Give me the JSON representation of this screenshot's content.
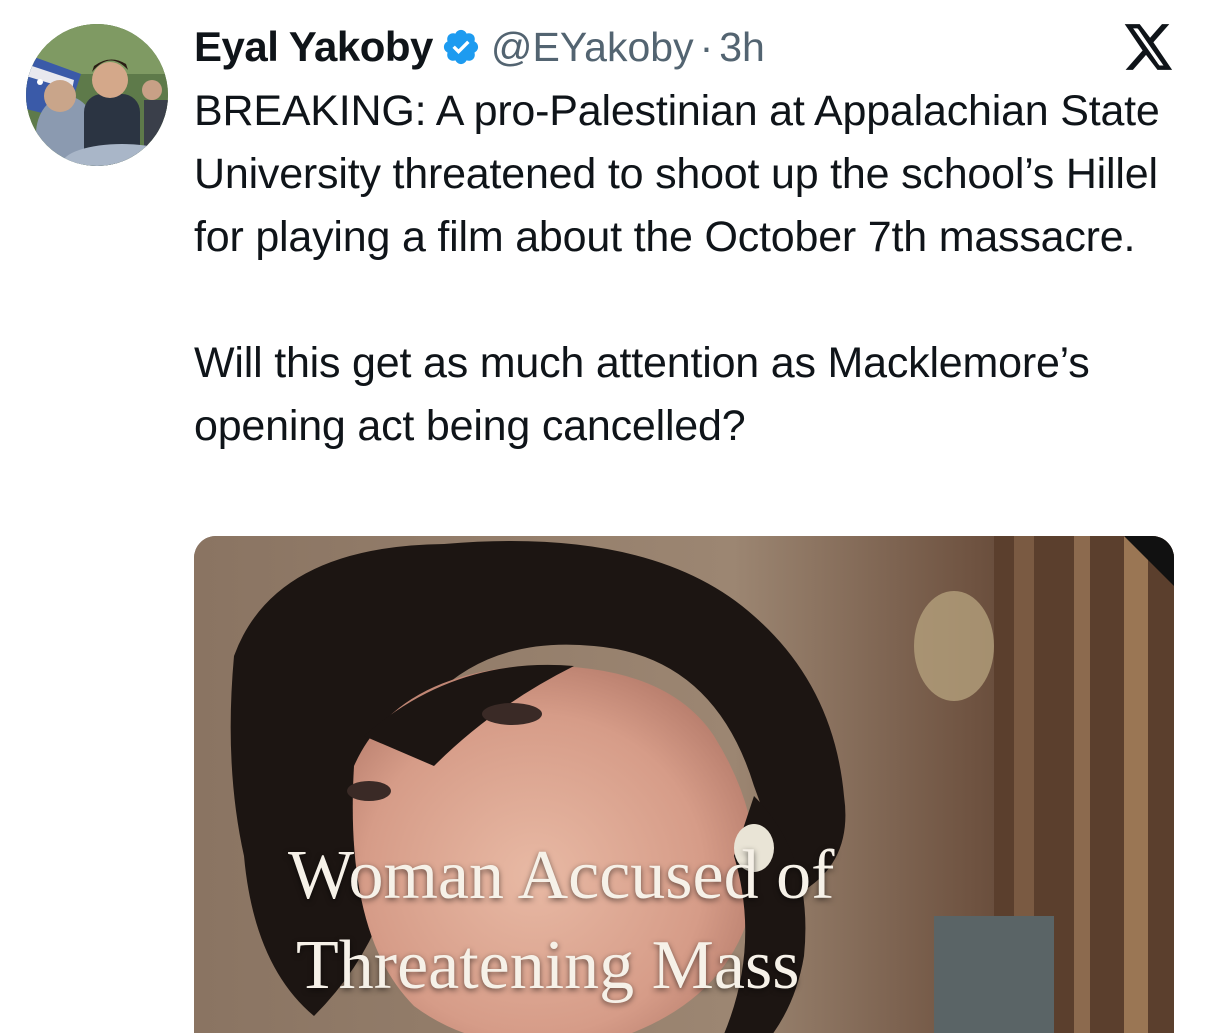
{
  "author": {
    "display_name": "Eyal Yakoby",
    "handle": "@EYakoby",
    "separator": "·",
    "time": "3h",
    "verified": true
  },
  "tweet": {
    "paragraph_1": "BREAKING: A pro-Palestinian at Appalachian State University threatened to shoot up the school’s Hillel for playing a film about the October 7th massacre.",
    "paragraph_2": "Will this get as much attention as Macklemore’s opening act being cancelled?"
  },
  "media": {
    "caption_line_1": "Woman Accused of",
    "caption_line_2": "Threatening Mass"
  },
  "icons": {
    "avatar": "profile-photo",
    "verified": "verified-badge-icon",
    "platform": "x-logo-icon"
  },
  "colors": {
    "text": "#0f1419",
    "secondary_text": "#536471",
    "verified_blue": "#1d9bf0",
    "background": "#ffffff"
  }
}
